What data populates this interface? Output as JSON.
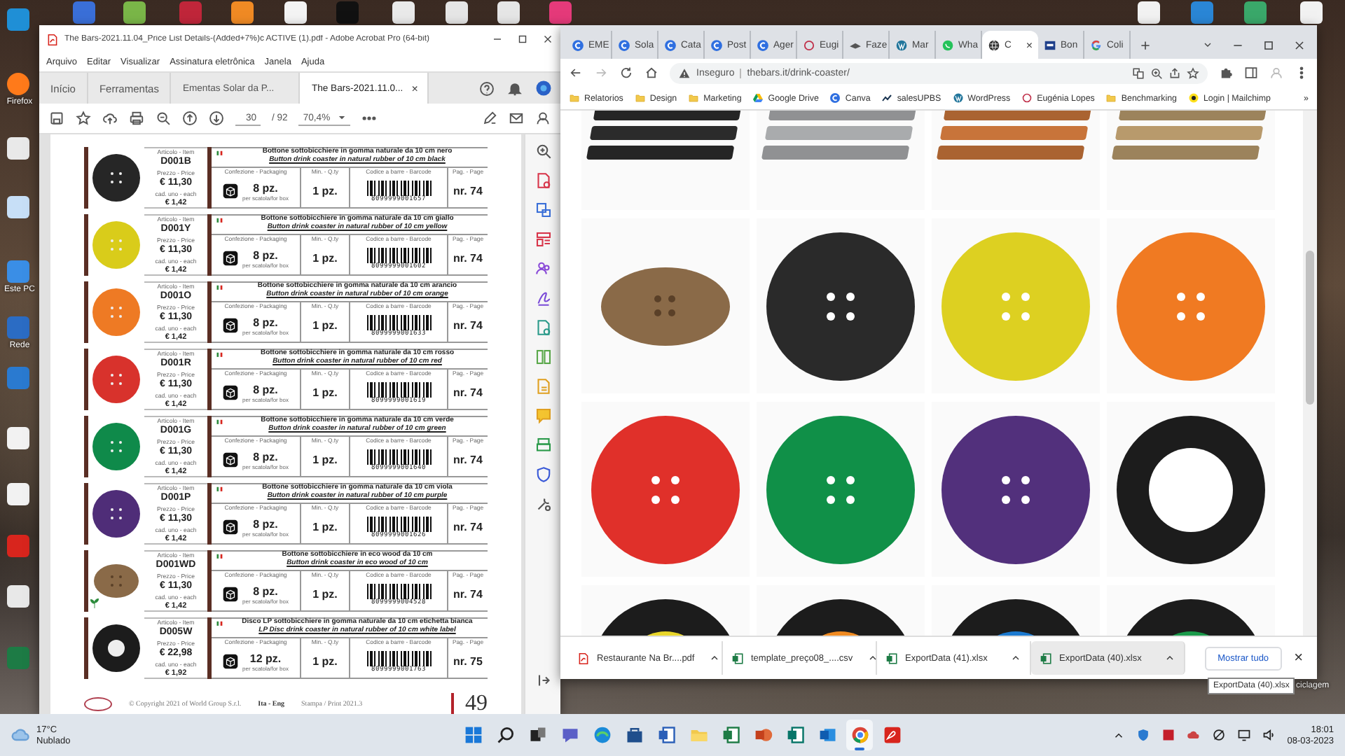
{
  "desktop": {
    "left_icons": [
      {
        "label": "Firefox",
        "kind": "firefox"
      },
      {
        "label": "Este PC",
        "kind": "pc"
      },
      {
        "label": "Rede",
        "kind": "network"
      }
    ],
    "right_label": "ciclagem"
  },
  "acrobat": {
    "title": "The Bars-2021.11.04_Price List Details-(Added+7%)c ACTIVE (1).pdf - Adobe Acrobat Pro (64-bit)",
    "menu": [
      "Arquivo",
      "Editar",
      "Visualizar",
      "Assinatura eletrônica",
      "Janela",
      "Ajuda"
    ],
    "tabs": [
      {
        "label": "Início",
        "kind": "home",
        "selected": false
      },
      {
        "label": "Ferramentas",
        "kind": "home",
        "selected": false
      },
      {
        "label": "Ementas Solar da P...",
        "kind": "doc",
        "selected": false
      },
      {
        "label": "The Bars-2021.11.0...",
        "kind": "doc",
        "selected": true
      }
    ],
    "tab_close": "×",
    "toolbar": {
      "page": "30",
      "total": "/ 92",
      "zoom": "70,4%"
    },
    "products": [
      {
        "kind": "button",
        "color": "#262626",
        "code": "D001B",
        "price": "€ 11,30",
        "each": "€ 1,42",
        "title_it": "Bottone sottobicchiere in gomma naturale da 10 cm nero",
        "title_en": "Button drink coaster in natural rubber of 10 cm black",
        "packaging": "8 pz.",
        "per_box": "per scatola/for box",
        "min": "1 pz.",
        "barcode": "8099999001657",
        "page": "nr. 74",
        "labels": {
          "item": "Articolo - Item",
          "price": "Prezzo - Price",
          "each": "cad. uno - each",
          "packaging": "Confezione - Packaging",
          "min": "Min. - Q.ty",
          "barcode": "Codice a barre - Barcode",
          "page": "Pag. - Page"
        }
      },
      {
        "kind": "button",
        "color": "#d9cc1a",
        "code": "D001Y",
        "price": "€ 11,30",
        "each": "€ 1,42",
        "title_it": "Bottone sottobicchiere in gomma naturale da 10 cm giallo",
        "title_en": "Button drink coaster in natural rubber of 10 cm yellow",
        "packaging": "8 pz.",
        "per_box": "per scatola/for box",
        "min": "1 pz.",
        "barcode": "8099999001602",
        "page": "nr. 74",
        "labels": {
          "item": "Articolo - Item",
          "price": "Prezzo - Price",
          "each": "cad. uno - each",
          "packaging": "Confezione - Packaging",
          "min": "Min. - Q.ty",
          "barcode": "Codice a barre - Barcode",
          "page": "Pag. - Page"
        }
      },
      {
        "kind": "button",
        "color": "#ee7a24",
        "code": "D001O",
        "price": "€ 11,30",
        "each": "€ 1,42",
        "title_it": "Bottone sottobicchiere in gomma naturale da 10 cm arancio",
        "title_en": "Button drink coaster in natural rubber of 10 cm orange",
        "packaging": "8 pz.",
        "per_box": "per scatola/for box",
        "min": "1 pz.",
        "barcode": "8099999001633",
        "page": "nr. 74",
        "labels": {
          "item": "Articolo - Item",
          "price": "Prezzo - Price",
          "each": "cad. uno - each",
          "packaging": "Confezione - Packaging",
          "min": "Min. - Q.ty",
          "barcode": "Codice a barre - Barcode",
          "page": "Pag. - Page"
        }
      },
      {
        "kind": "button",
        "color": "#d8322c",
        "code": "D001R",
        "price": "€ 11,30",
        "each": "€ 1,42",
        "title_it": "Bottone sottobicchiere in gomma naturale da 10 cm rosso",
        "title_en": "Button drink coaster in natural rubber of 10 cm red",
        "packaging": "8 pz.",
        "per_box": "per scatola/for box",
        "min": "1 pz.",
        "barcode": "8099999001619",
        "page": "nr. 74",
        "labels": {
          "item": "Articolo - Item",
          "price": "Prezzo - Price",
          "each": "cad. uno - each",
          "packaging": "Confezione - Packaging",
          "min": "Min. - Q.ty",
          "barcode": "Codice a barre - Barcode",
          "page": "Pag. - Page"
        }
      },
      {
        "kind": "button",
        "color": "#0f8a4a",
        "code": "D001G",
        "price": "€ 11,30",
        "each": "€ 1,42",
        "title_it": "Bottone sottobicchiere in gomma naturale da 10 cm verde",
        "title_en": "Button drink coaster in natural rubber of 10 cm green",
        "packaging": "8 pz.",
        "per_box": "per scatola/for box",
        "min": "1 pz.",
        "barcode": "8099999001640",
        "page": "nr. 74",
        "labels": {
          "item": "Articolo - Item",
          "price": "Prezzo - Price",
          "each": "cad. uno - each",
          "packaging": "Confezione - Packaging",
          "min": "Min. - Q.ty",
          "barcode": "Codice a barre - Barcode",
          "page": "Pag. - Page"
        }
      },
      {
        "kind": "button",
        "color": "#4f2d78",
        "code": "D001P",
        "price": "€ 11,30",
        "each": "€ 1,42",
        "title_it": "Bottone sottobicchiere in gomma naturale da 10 cm viola",
        "title_en": "Button drink coaster in natural rubber of 10 cm purple",
        "packaging": "8 pz.",
        "per_box": "per scatola/for box",
        "min": "1 pz.",
        "barcode": "8099999001626",
        "page": "nr. 74",
        "labels": {
          "item": "Articolo - Item",
          "price": "Prezzo - Price",
          "each": "cad. uno - each",
          "packaging": "Confezione - Packaging",
          "min": "Min. - Q.ty",
          "barcode": "Codice a barre - Barcode",
          "page": "Pag. - Page"
        }
      },
      {
        "kind": "wood",
        "color": "#8a6a48",
        "code": "D001WD",
        "price": "€ 11,30",
        "each": "€ 1,42",
        "title_it": "Bottone sottobicchiere in eco wood da 10 cm",
        "title_en": "Button drink coaster in eco wood of 10 cm",
        "packaging": "8 pz.",
        "per_box": "per scatola/for box",
        "min": "1 pz.",
        "barcode": "8099999004528",
        "page": "nr. 74",
        "labels": {
          "item": "Articolo - Item",
          "price": "Prezzo - Price",
          "each": "cad. uno - each",
          "packaging": "Confezione - Packaging",
          "min": "Min. - Q.ty",
          "barcode": "Codice a barre - Barcode",
          "page": "Pag. - Page"
        }
      },
      {
        "kind": "disc",
        "color": "#1c1c1c",
        "code": "D005W",
        "price": "€ 22,98",
        "each": "€ 1,92",
        "title_it": "Disco LP sottobicchiere in gomma naturale da 10 cm etichetta bianca",
        "title_en": "LP Disc drink coaster in natural rubber of 10 cm white label",
        "packaging": "12 pz.",
        "per_box": "per scatola/for box",
        "min": "1 pz.",
        "barcode": "8099999001763",
        "page": "nr. 75",
        "labels": {
          "item": "Articolo - Item",
          "price": "Prezzo - Price",
          "each": "cad. uno - each",
          "packaging": "Confezione - Packaging",
          "min": "Min. - Q.ty",
          "barcode": "Codice a barre - Barcode",
          "page": "Pag. - Page"
        }
      }
    ],
    "footer": {
      "copyright": "© Copyright 2021 of World Group S.r.l.",
      "languages": "Ita - Eng",
      "print": "Stampa / Print 2021.3",
      "page_number": "49"
    }
  },
  "chrome": {
    "tabs": [
      {
        "label": "EME",
        "kind": "c",
        "selected": false
      },
      {
        "label": "Sola",
        "kind": "c",
        "selected": false
      },
      {
        "label": "Cata",
        "kind": "c",
        "selected": false
      },
      {
        "label": "Post",
        "kind": "c",
        "selected": false
      },
      {
        "label": "Ager",
        "kind": "c",
        "selected": false
      },
      {
        "label": "Eugi",
        "kind": "ring",
        "selected": false
      },
      {
        "label": "Faze",
        "kind": "hat",
        "selected": false
      },
      {
        "label": "Mar",
        "kind": "wp",
        "selected": false
      },
      {
        "label": "Wha",
        "kind": "chat",
        "selected": false
      },
      {
        "label": "C",
        "kind": "globe",
        "selected": true
      },
      {
        "label": "Bon",
        "kind": "square",
        "selected": false
      },
      {
        "label": "Coli",
        "kind": "g",
        "selected": false
      }
    ],
    "tab_close": "×",
    "address": {
      "security": "Inseguro",
      "url": "thebars.it/drink-coaster/"
    },
    "bookmarks": [
      {
        "label": "Relatorios",
        "kind": "folder"
      },
      {
        "label": "Design",
        "kind": "folder"
      },
      {
        "label": "Marketing",
        "kind": "folder"
      },
      {
        "label": "Google Drive",
        "kind": "drive"
      },
      {
        "label": "Canva",
        "kind": "c"
      },
      {
        "label": "salesUPBS",
        "kind": "chart"
      },
      {
        "label": "WordPress",
        "kind": "wp"
      },
      {
        "label": "Eugénia Lopes",
        "kind": "ring"
      },
      {
        "label": "Benchmarking",
        "kind": "folder"
      },
      {
        "label": "Login | Mailchimp",
        "kind": "mail"
      }
    ],
    "bookmarks_more": "»",
    "tiles": [
      {
        "kind": "pallet",
        "color": "#2b2b2b"
      },
      {
        "kind": "pallet",
        "color": "#a9abad"
      },
      {
        "kind": "pallet",
        "color": "#c8743a"
      },
      {
        "kind": "pallet",
        "color": "#b89a6c"
      },
      {
        "kind": "wood",
        "color": "#8a6a48"
      },
      {
        "kind": "button",
        "color": "#2a2a2a"
      },
      {
        "kind": "button",
        "color": "#ddd021"
      },
      {
        "kind": "button",
        "color": "#f07a22"
      },
      {
        "kind": "button",
        "color": "#e0302a"
      },
      {
        "kind": "button",
        "color": "#109048"
      },
      {
        "kind": "button",
        "color": "#52307c"
      },
      {
        "kind": "disc",
        "color": "#ffffff"
      },
      {
        "kind": "disc",
        "color": "#e8d52a"
      },
      {
        "kind": "disc",
        "color": "#f08a20"
      },
      {
        "kind": "disc",
        "color": "#1c7ad0"
      },
      {
        "kind": "disc",
        "color": "#1a9a4a"
      }
    ],
    "downloads": [
      {
        "name": "Restaurante Na Br....pdf",
        "kind": "pdf",
        "selected": false
      },
      {
        "name": "template_preço08_....csv",
        "kind": "sheet",
        "selected": false
      },
      {
        "name": "ExportData (41).xlsx",
        "kind": "sheet",
        "selected": false
      },
      {
        "name": "ExportData (40).xlsx",
        "kind": "sheet",
        "selected": true
      }
    ],
    "show_all": "Mostrar tudo",
    "close": "×"
  },
  "tooltip": "ExportData (40).xlsx",
  "taskbar": {
    "weather": {
      "temperature": "17°C",
      "condition": "Nublado"
    },
    "apps": [
      {
        "kind": "start",
        "active": false
      },
      {
        "kind": "search",
        "active": false
      },
      {
        "kind": "taskview",
        "active": false
      },
      {
        "kind": "chat",
        "active": false
      },
      {
        "kind": "edge",
        "active": false
      },
      {
        "kind": "store",
        "active": false
      },
      {
        "kind": "word",
        "active": false
      },
      {
        "kind": "files",
        "active": false
      },
      {
        "kind": "excel",
        "active": false
      },
      {
        "kind": "powerpoint",
        "active": false
      },
      {
        "kind": "publisher",
        "active": false
      },
      {
        "kind": "outlook",
        "active": false
      },
      {
        "kind": "chrome",
        "active": true
      },
      {
        "kind": "acrobat",
        "active": false
      }
    ],
    "time": "18:01",
    "date": "08-03-2023"
  }
}
